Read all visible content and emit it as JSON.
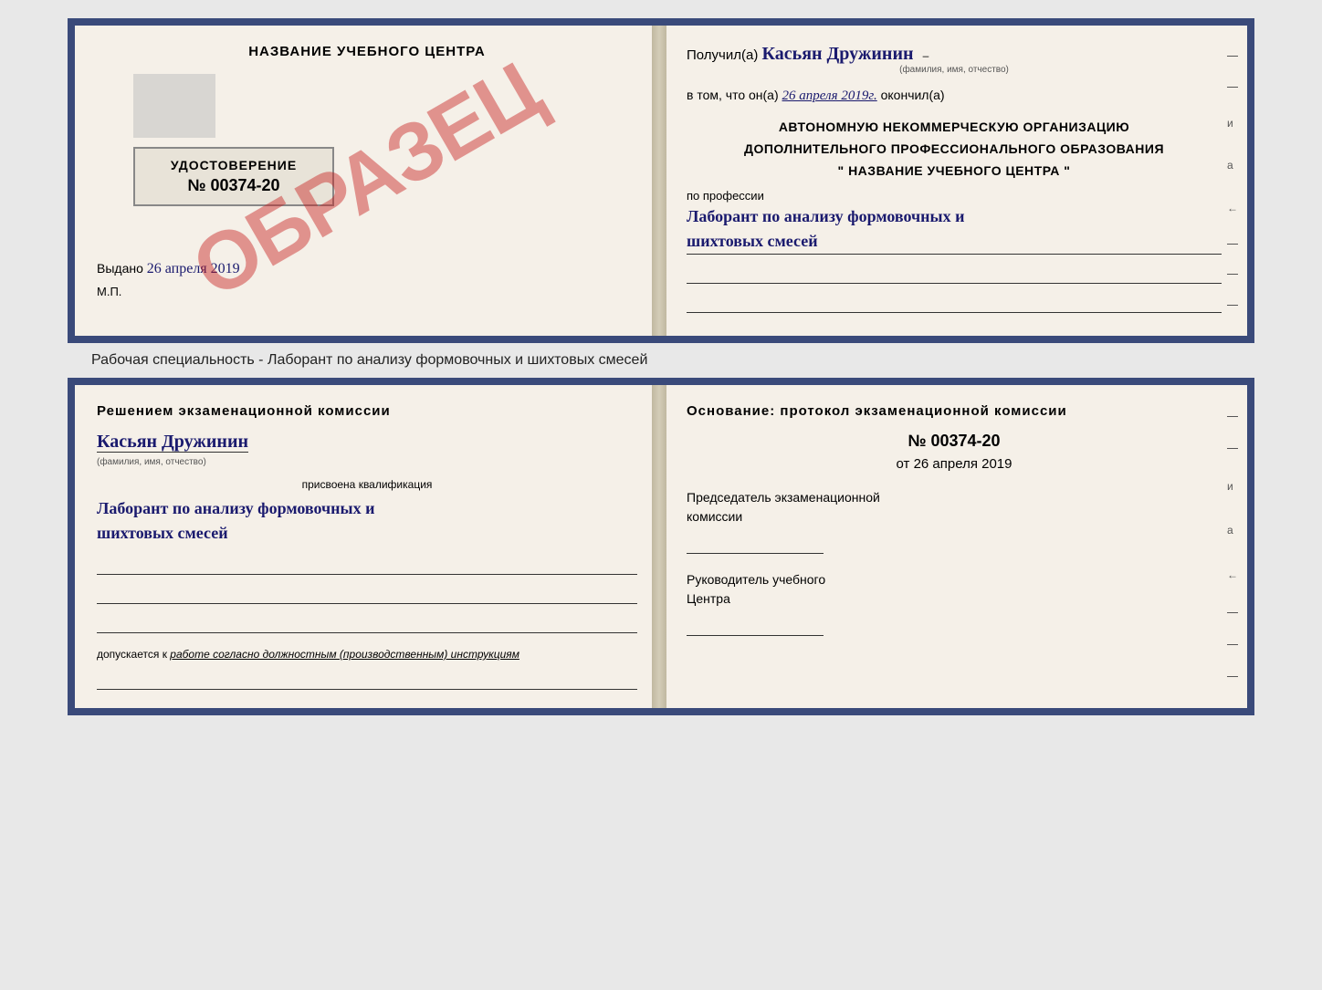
{
  "page": {
    "background": "#e8e8e8"
  },
  "cert_top": {
    "left": {
      "title": "НАЗВАНИЕ УЧЕБНОГО ЦЕНТРА",
      "watermark": "ОБРАЗЕЦ",
      "udostoverenie": {
        "label": "УДОСТОВЕРЕНИЕ",
        "number": "№ 00374-20"
      },
      "vydano": "Выдано",
      "vydano_date": "26 апреля 2019",
      "mp": "М.П."
    },
    "right": {
      "poluchil": "Получил(а)",
      "name_handwrite": "Касьян Дружинин",
      "name_sublabel": "(фамилия, имя, отчество)",
      "vtom_prefix": "в том, что он(а)",
      "vtom_date": "26 апреля 2019г.",
      "okonchil": "окончил(а)",
      "org_line1": "АВТОНОМНУЮ НЕКОММЕРЧЕСКУЮ ОРГАНИЗАЦИЮ",
      "org_line2": "ДОПОЛНИТЕЛЬНОГО ПРОФЕССИОНАЛЬНОГО ОБРАЗОВАНИЯ",
      "org_line3": "\"   НАЗВАНИЕ УЧЕБНОГО ЦЕНТРА   \"",
      "po_professii": "по профессии",
      "prof_handwrite_line1": "Лаборант по анализу формовочных и",
      "prof_handwrite_line2": "шихтовых смесей"
    }
  },
  "specialty_line": "Рабочая специальность - Лаборант по анализу формовочных и шихтовых смесей",
  "cert_bottom": {
    "left": {
      "resheniem": "Решением экзаменационной комиссии",
      "name_handwrite": "Касьян Дружинин",
      "name_sublabel": "(фамилия, имя, отчество)",
      "prisvoena": "присвоена квалификация",
      "kvalif_line1": "Лаборант по анализу формовочных и",
      "kvalif_line2": "шихтовых смесей",
      "dopuskaetsya": "допускается к",
      "dopusk_text": "работе согласно должностным (производственным) инструкциям"
    },
    "right": {
      "osnovanie": "Основание: протокол экзаменационной комиссии",
      "protocol_num": "№ 00374-20",
      "ot_prefix": "от",
      "ot_date": "26 апреля 2019",
      "predsedatel_line1": "Председатель экзаменационной",
      "predsedatel_line2": "комиссии",
      "rukovoditel_line1": "Руководитель учебного",
      "rukovoditel_line2": "Центра"
    }
  },
  "side_labels": {
    "items": [
      "–",
      "–",
      "и",
      "а",
      "←",
      "–",
      "–",
      "–"
    ]
  }
}
